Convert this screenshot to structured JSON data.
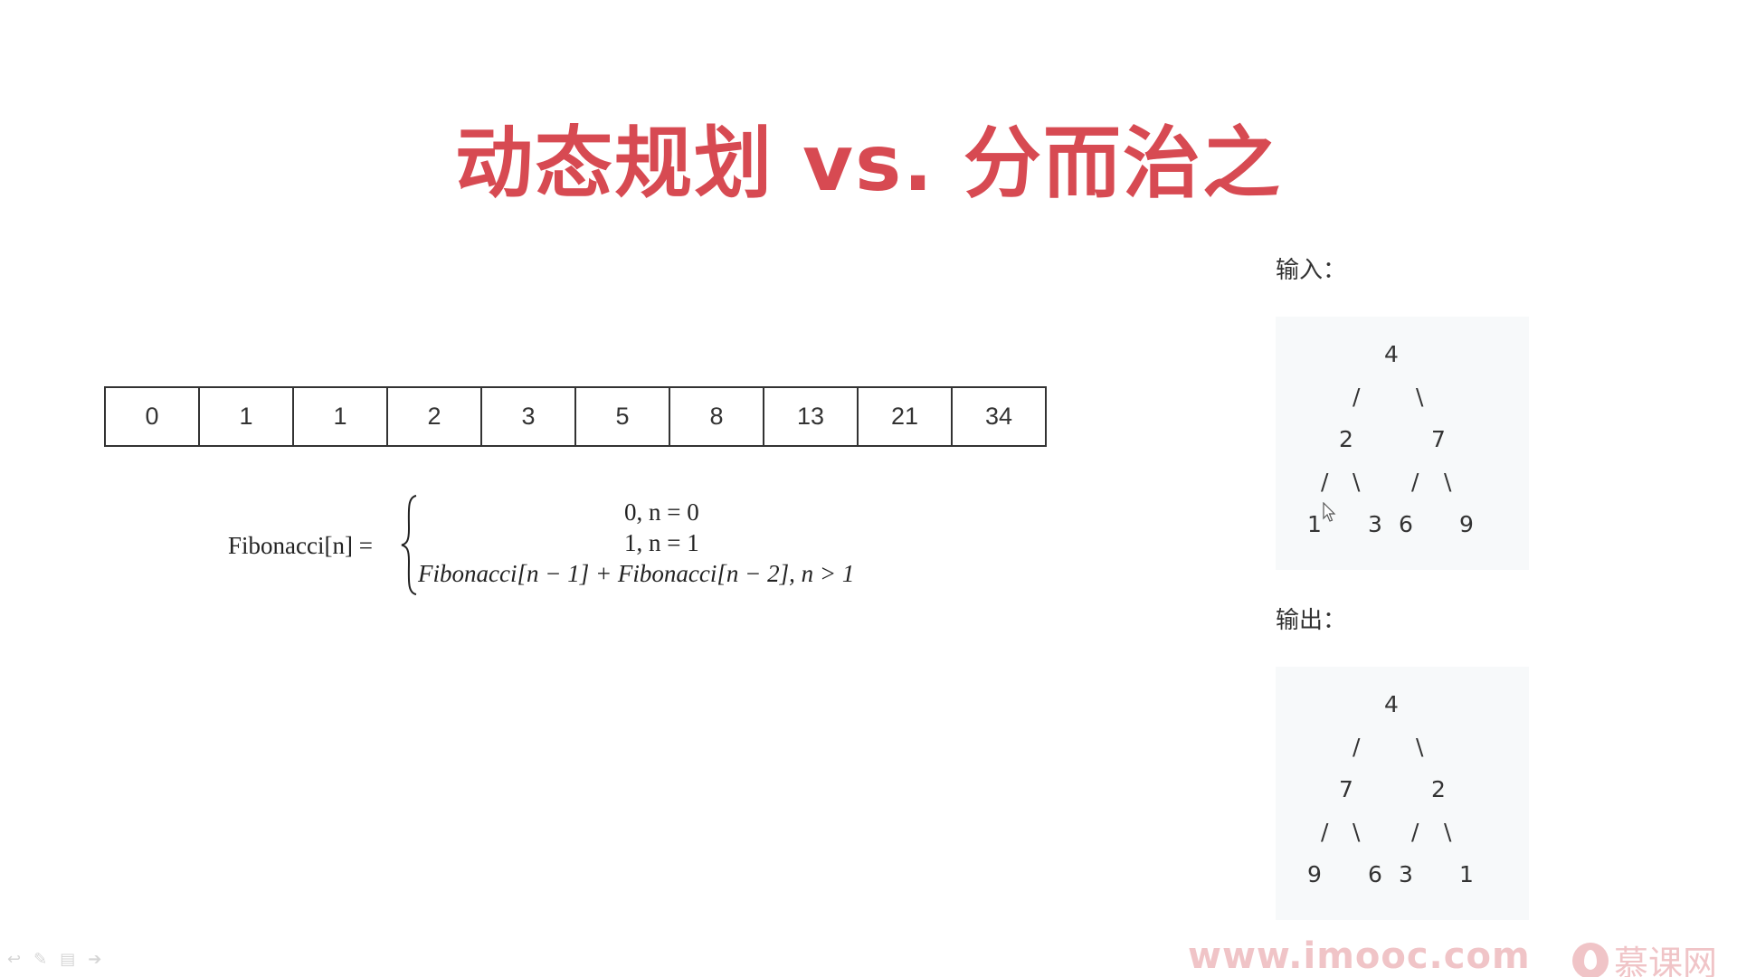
{
  "slide": {
    "title": "动态规划 vs. 分而治之"
  },
  "fib_sequence": [
    "0",
    "1",
    "1",
    "2",
    "3",
    "5",
    "8",
    "13",
    "21",
    "34"
  ],
  "formula": {
    "lhs": "Fibonacci[n] =",
    "case1": "0, n = 0",
    "case2": "1, n = 1",
    "case3": "Fibonacci[n − 1] + Fibonacci[n − 2], n > 1"
  },
  "input_section": {
    "label": "输入：",
    "tree": {
      "root": "4",
      "level1": [
        "2",
        "7"
      ],
      "level2": [
        "1",
        "3",
        "6",
        "9"
      ]
    }
  },
  "output_section": {
    "label": "输出：",
    "tree": {
      "root": "4",
      "level1": [
        "7",
        "2"
      ],
      "level2": [
        "9",
        "6",
        "3",
        "1"
      ]
    }
  },
  "footer": {
    "watermark": "www.imooc.com",
    "brand": "慕课网"
  },
  "toolbar_icons": [
    "undo-icon",
    "pen-icon",
    "menu-icon",
    "forward-icon"
  ],
  "colors": {
    "title": "#d74a52",
    "watermark": "#f0c4c7",
    "tree_bg": "#f7f9fa"
  }
}
